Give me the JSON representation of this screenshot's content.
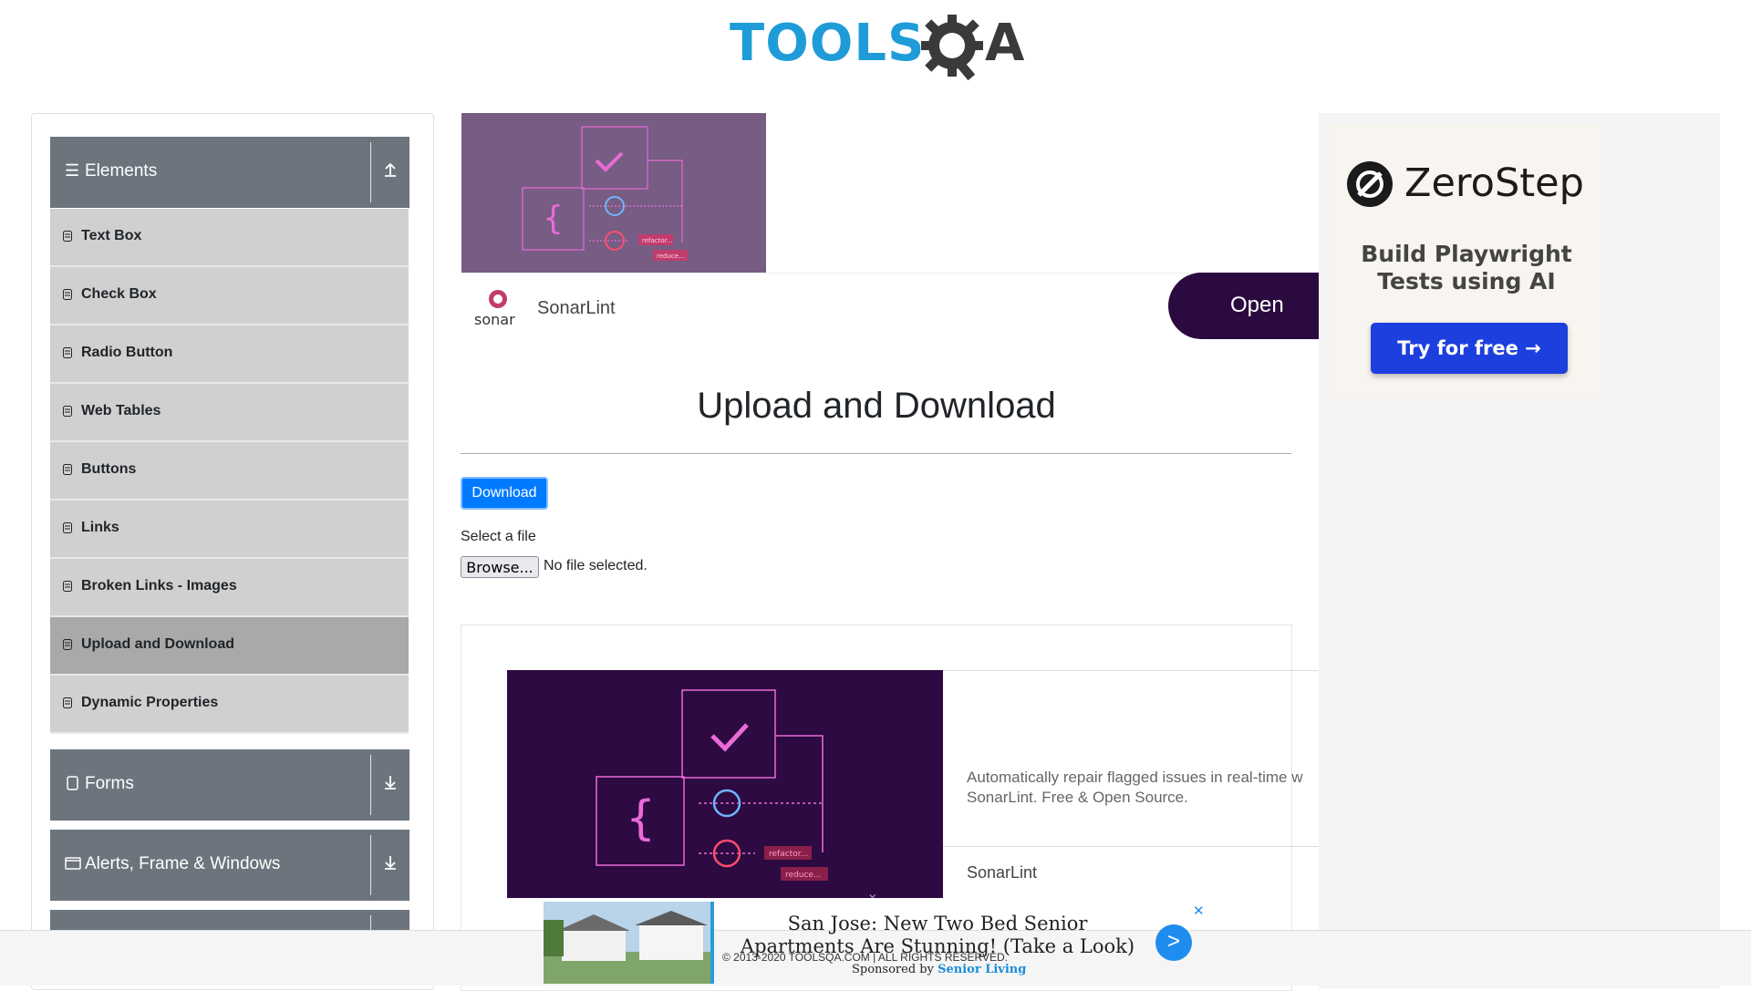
{
  "header": {
    "logo_text_left": "TOOLS",
    "logo_text_right": "A",
    "logo_alt": "TOOLSQA"
  },
  "sidebar": {
    "groups": [
      {
        "label": "Elements",
        "icon": "hamburger-icon",
        "toggle_icon": "arrow-up-icon"
      },
      {
        "label": "Forms",
        "icon": "document-icon",
        "toggle_icon": "arrow-down-icon"
      },
      {
        "label": "Alerts, Frame & Windows",
        "icon": "window-icon",
        "toggle_icon": "arrow-down-icon"
      }
    ],
    "items": [
      {
        "label": "Text Box"
      },
      {
        "label": "Check Box"
      },
      {
        "label": "Radio Button"
      },
      {
        "label": "Web Tables"
      },
      {
        "label": "Buttons"
      },
      {
        "label": "Links"
      },
      {
        "label": "Broken Links - Images"
      },
      {
        "label": "Upload and Download",
        "active": true
      },
      {
        "label": "Dynamic Properties"
      }
    ]
  },
  "ad_top": {
    "brand": "sonar",
    "name": "SonarLint",
    "cta": "Open",
    "img_labels": [
      "refactor...",
      "reduce..."
    ]
  },
  "main": {
    "title": "Upload and Download",
    "download_label": "Download",
    "select_label": "Select a file",
    "browse_label": "Browse...",
    "no_file_label": "No file selected."
  },
  "ad_mid": {
    "description": "Automatically repair flagged issues in real-time w",
    "description2": "SonarLint. Free & Open Source.",
    "name": "SonarLint",
    "chevron": "⌄",
    "img_labels": [
      "refactor...",
      "reduce..."
    ]
  },
  "ad_right": {
    "brand": "ZeroStep",
    "line1": "Build Playwright",
    "line2": "Tests using AI",
    "cta": "Try for free →"
  },
  "footer": {
    "copyright": "© 2013-2020 TOOLSQA.COM | ALL RIGHTS RESERVED."
  },
  "sticky_ad": {
    "headline": "San Jose: New Two Bed Senior Apartments Are Stunning! (Take a Look)",
    "sponsored_prefix": "Sponsored by ",
    "sponsor": "Senior Living",
    "go": ">",
    "close": "✕"
  },
  "colors": {
    "sidebar_group": "#6c757d",
    "menu_item": "#d0d0d0",
    "menu_active": "#a9a9a9",
    "primary": "#007bff",
    "logo_blue": "#1f9cd8"
  }
}
